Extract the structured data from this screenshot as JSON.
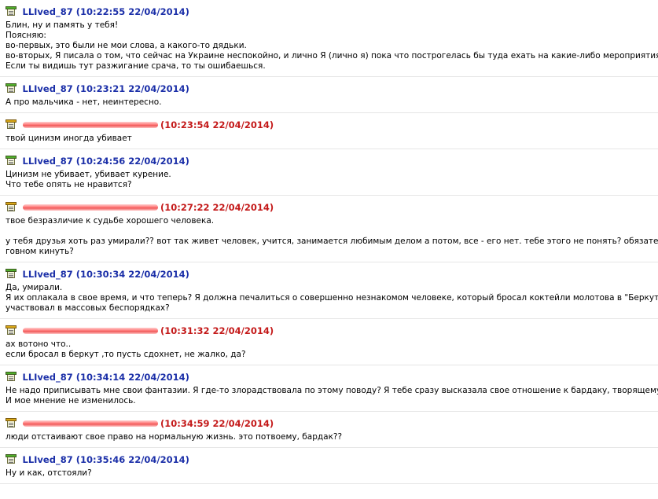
{
  "colors": {
    "author": "#1b2fa8",
    "other": "#c41a1a",
    "separator": "#e6e6e6"
  },
  "icons": {
    "self": "green-notepad-icon",
    "other": "yellow-notepad-icon"
  },
  "messages": [
    {
      "type": "self",
      "author": "LLIved_87",
      "time": "(10:22:55 22/04/2014)",
      "lines": [
        "Блин, ну и память у тебя!",
        "Поясняю:",
        "во-первых, это были не мои слова, а какого-то дядьки.",
        "во-вторых, Я писала о том, что сейчас на Украине неспокойно, и лично Я (лично я) пока что построгелась бы туда ехать на какие-либо мероприятия.",
        "Если ты видишь тут разжигание срача, то ты ошибаешься."
      ]
    },
    {
      "type": "self",
      "author": "LLIved_87",
      "time": "(10:23:21 22/04/2014)",
      "lines": [
        "А про мальчика - нет, неинтересно."
      ]
    },
    {
      "type": "other",
      "author": "",
      "time": "(10:23:54 22/04/2014)",
      "lines": [
        "твой цинизм иногда убивает"
      ]
    },
    {
      "type": "self",
      "author": "LLIved_87",
      "time": "(10:24:56 22/04/2014)",
      "lines": [
        "Цинизм не убивает, убивает курение.",
        "Что тебе опять не нравится?"
      ]
    },
    {
      "type": "other",
      "author": "",
      "time": "(10:27:22 22/04/2014)",
      "lines": [
        "твое безразличие к судьбе хорошего человека.",
        "",
        "у тебя друзья хоть раз умирали?? вот так живет человек, учится, занимается любимым делом а потом, все - его нет. тебе этого не понять? обязательно надо",
        "говном кинуть?"
      ]
    },
    {
      "type": "self",
      "author": "LLIved_87",
      "time": "(10:30:34 22/04/2014)",
      "lines": [
        "Да, умирали.",
        "Я их оплакала в свое время, и что теперь? Я должна печалиться о совершенно незнакомом человеке, который бросал коктейли молотова в \"Беркут\" и",
        "участвовал в массовых беспорядках?"
      ]
    },
    {
      "type": "other",
      "author": "",
      "time": "(10:31:32 22/04/2014)",
      "lines": [
        "ах вотоно что..",
        "если бросал в беркут ,то пусть сдохнет, не жалко, да?"
      ]
    },
    {
      "type": "self",
      "author": "LLIved_87",
      "time": "(10:34:14 22/04/2014)",
      "lines": [
        "Не надо приписывать мне свои фантазии. Я где-то злорадствовала по этому поводу? Я тебе сразу высказала свое отношение к бардаку, творящемуся у вас.",
        "И мое мнение не изменилось."
      ]
    },
    {
      "type": "other",
      "author": "",
      "time": "(10:34:59 22/04/2014)",
      "lines": [
        "люди отстаивают свое право на нормальную жизнь. это потвоему, бардак??"
      ]
    },
    {
      "type": "self",
      "author": "LLIved_87",
      "time": "(10:35:46 22/04/2014)",
      "lines": [
        "Ну и как, отстояли?"
      ]
    }
  ]
}
